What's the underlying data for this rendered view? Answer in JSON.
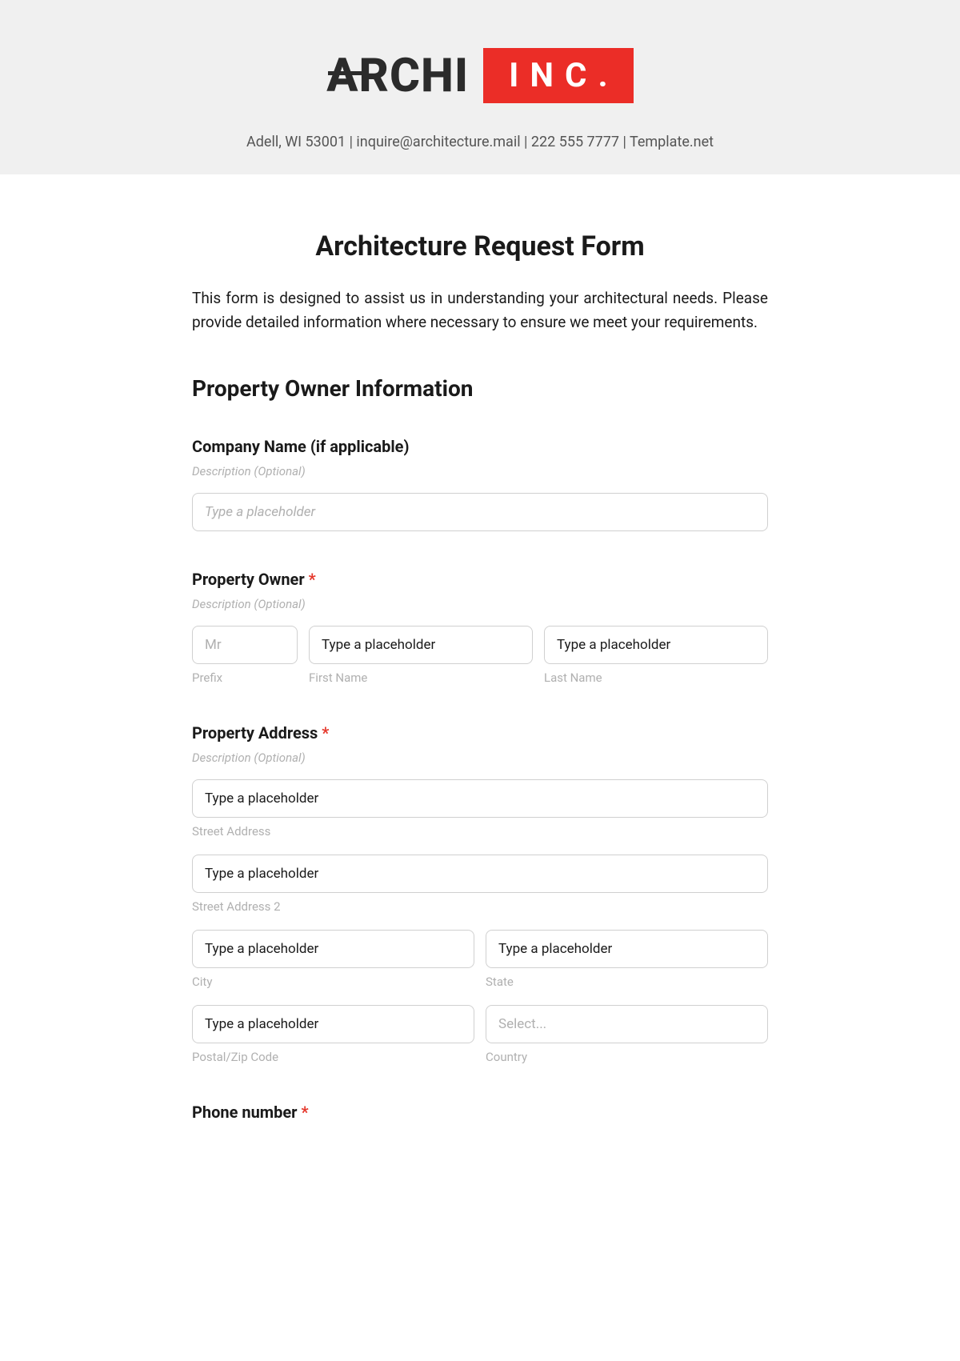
{
  "logo": {
    "part1": "ARCHI",
    "part2": "INC."
  },
  "header": {
    "contact": "Adell, WI 53001 | inquire@architecture.mail | 222 555 7777 | Template.net"
  },
  "form": {
    "title": "Architecture Request Form",
    "intro": "This form is designed to assist us in understanding your architectural needs. Please provide detailed information where necessary to ensure we meet your requirements.",
    "section_owner": "Property Owner Information",
    "company": {
      "label": "Company Name (if applicable)",
      "description": "Description (Optional)",
      "placeholder": "Type a placeholder"
    },
    "owner": {
      "label": "Property Owner ",
      "required": "*",
      "description": "Description (Optional)",
      "prefix_placeholder": "Mr",
      "prefix_sub": "Prefix",
      "first_placeholder": "Type a placeholder",
      "first_sub": "First Name",
      "last_placeholder": "Type a placeholder",
      "last_sub": "Last Name"
    },
    "address": {
      "label": "Property Address ",
      "required": "*",
      "description": "Description (Optional)",
      "street_placeholder": "Type a placeholder",
      "street_sub": "Street Address",
      "street2_placeholder": "Type a placeholder",
      "street2_sub": "Street Address 2",
      "city_placeholder": "Type a placeholder",
      "city_sub": "City",
      "state_placeholder": "Type a placeholder",
      "state_sub": "State",
      "postal_placeholder": "Type a placeholder",
      "postal_sub": "Postal/Zip Code",
      "country_placeholder": "Select...",
      "country_sub": "Country"
    },
    "phone": {
      "label": "Phone number ",
      "required": "*"
    }
  }
}
